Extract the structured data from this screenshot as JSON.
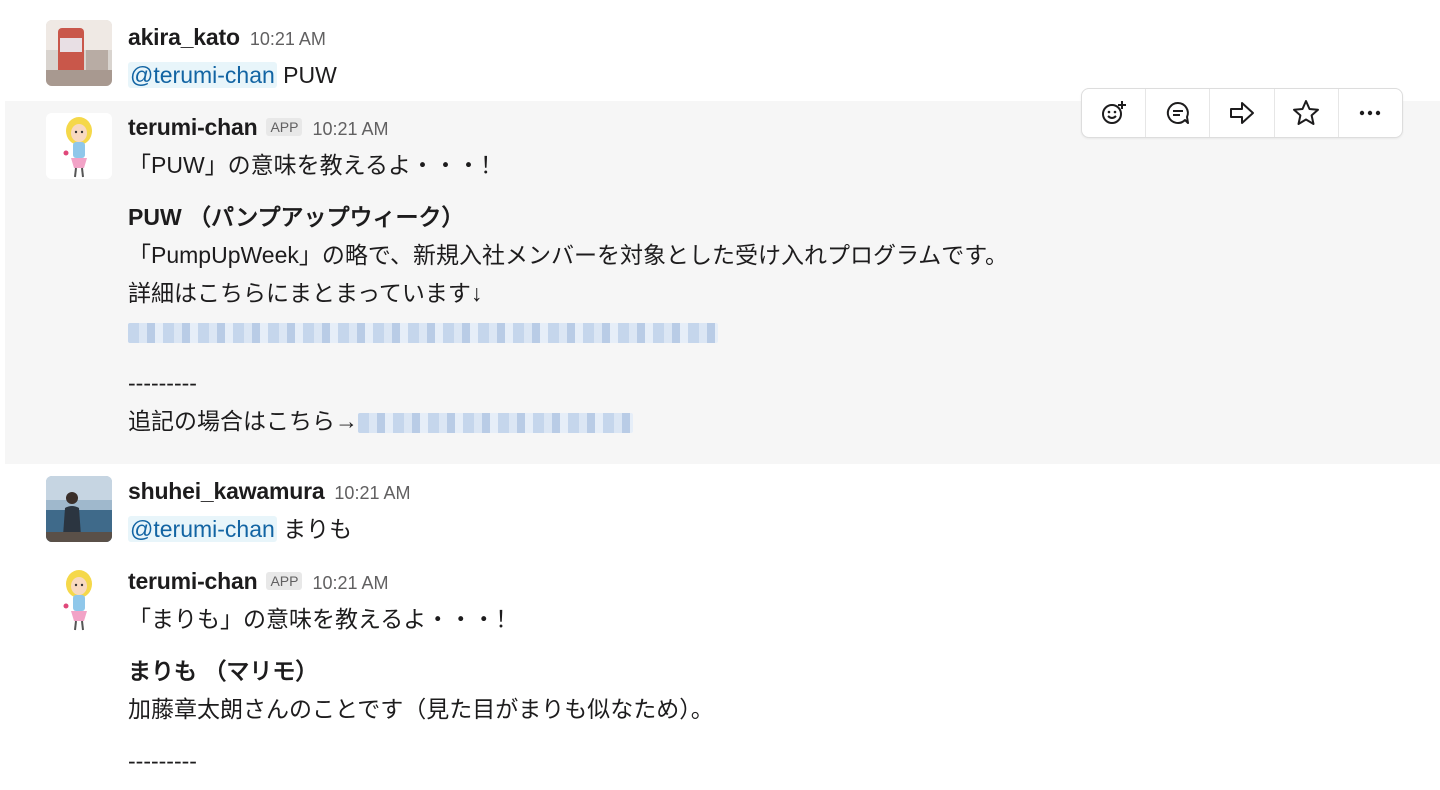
{
  "messages": [
    {
      "user": "akira_kato",
      "time": "10:21 AM",
      "mention": "@terumi-chan",
      "text": " PUW"
    },
    {
      "user": "terumi-chan",
      "badge": "APP",
      "time": "10:21 AM",
      "intro": "「PUW」の意味を教えるよ・・・！",
      "term": "PUW （パンプアップウィーク）",
      "def1": "「PumpUpWeek」の略で、新規入社メンバーを対象とした受け入れプログラムです。",
      "def2": "詳細はこちらにまとまっています↓",
      "divider": "---------",
      "addendum": "追記の場合はこちら→"
    },
    {
      "user": "shuhei_kawamura",
      "time": "10:21 AM",
      "mention": "@terumi-chan",
      "text": " まりも"
    },
    {
      "user": "terumi-chan",
      "badge": "APP",
      "time": "10:21 AM",
      "intro": "「まりも」の意味を教えるよ・・・！",
      "term": "まりも （マリモ）",
      "def1": "加藤章太朗さんのことです（見た目がまりも似なため）。",
      "divider": "---------"
    }
  ],
  "toolbar": {
    "icons": [
      "add-reaction-icon",
      "reply-thread-icon",
      "share-icon",
      "star-icon",
      "more-actions-icon"
    ]
  },
  "colors": {
    "hover_bg": "#f6f6f6",
    "mention_text": "#1264a3",
    "mention_bg": "#e8f5fa",
    "time_text": "#616061"
  }
}
